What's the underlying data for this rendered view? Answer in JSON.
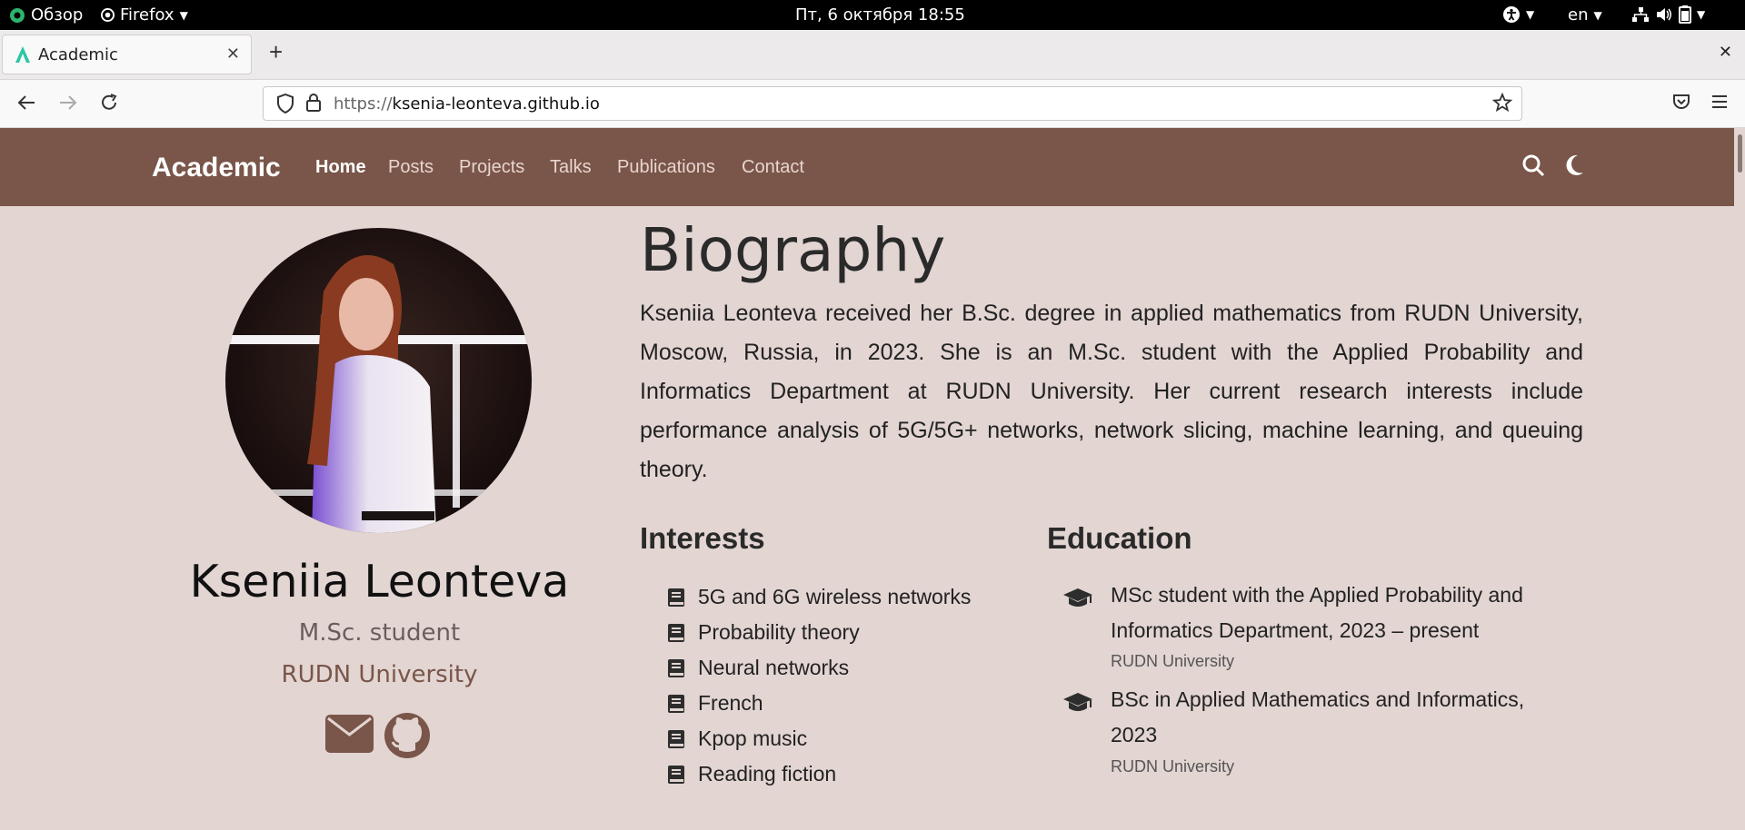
{
  "system_bar": {
    "overview": "Обзор",
    "app": "Firefox",
    "datetime": "Пт, 6 октября  18:55",
    "lang": "en"
  },
  "browser": {
    "tab_title": "Academic",
    "url_proto": "https://",
    "url_host": "ksenia-leonteva.github.io"
  },
  "site": {
    "brand": "Academic",
    "nav": [
      {
        "label": "Home",
        "active": true
      },
      {
        "label": "Posts"
      },
      {
        "label": "Projects"
      },
      {
        "label": "Talks"
      },
      {
        "label": "Publications"
      },
      {
        "label": "Contact"
      }
    ]
  },
  "profile": {
    "name": "Kseniia Leonteva",
    "role": "M.Sc. student",
    "organization": "RUDN University"
  },
  "biography": {
    "heading": "Biography",
    "text": "Kseniia Leonteva received her B.Sc. degree in applied mathematics from RUDN University, Moscow, Russia, in 2023. She is an M.Sc. student with the Applied Probability and Informatics Department at RUDN University. Her current research interests include performance analysis of 5G/5G+ networks, network slicing, machine learning, and queuing theory."
  },
  "interests": {
    "heading": "Interests",
    "items": [
      "5G and 6G wireless networks",
      "Probability theory",
      "Neural networks",
      "French",
      "Kpop music",
      "Reading fiction"
    ]
  },
  "education": {
    "heading": "Education",
    "items": [
      {
        "degree": "MSc student with the Applied Probability and Informatics Department, 2023 – present",
        "institution": "RUDN University"
      },
      {
        "degree": "BSc in Applied Mathematics and Informatics, 2023",
        "institution": "RUDN University"
      }
    ]
  },
  "colors": {
    "navbar": "#7a5549",
    "page_bg": "#e2d5d2",
    "accent": "#7a5549"
  }
}
